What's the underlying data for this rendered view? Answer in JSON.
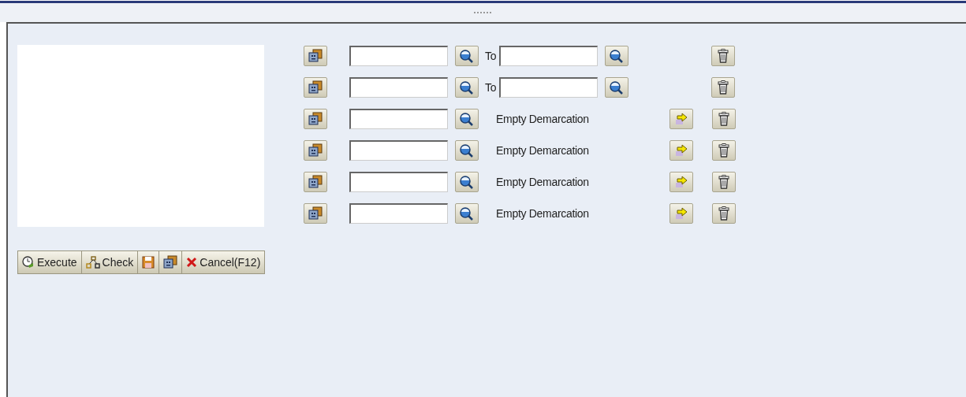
{
  "rows": [
    {
      "kind": "range",
      "to_label": "To"
    },
    {
      "kind": "range",
      "to_label": "To"
    },
    {
      "kind": "single",
      "status": "Empty Demarcation"
    },
    {
      "kind": "single",
      "status": "Empty Demarcation"
    },
    {
      "kind": "single",
      "status": "Empty Demarcation"
    },
    {
      "kind": "single",
      "status": "Empty Demarcation"
    }
  ],
  "toolbar": [
    {
      "kind": "execute",
      "label": "Execute"
    },
    {
      "kind": "check",
      "label": "Check"
    },
    {
      "kind": "save"
    },
    {
      "kind": "variant"
    },
    {
      "kind": "cancel",
      "label": "Cancel(F12)"
    }
  ]
}
